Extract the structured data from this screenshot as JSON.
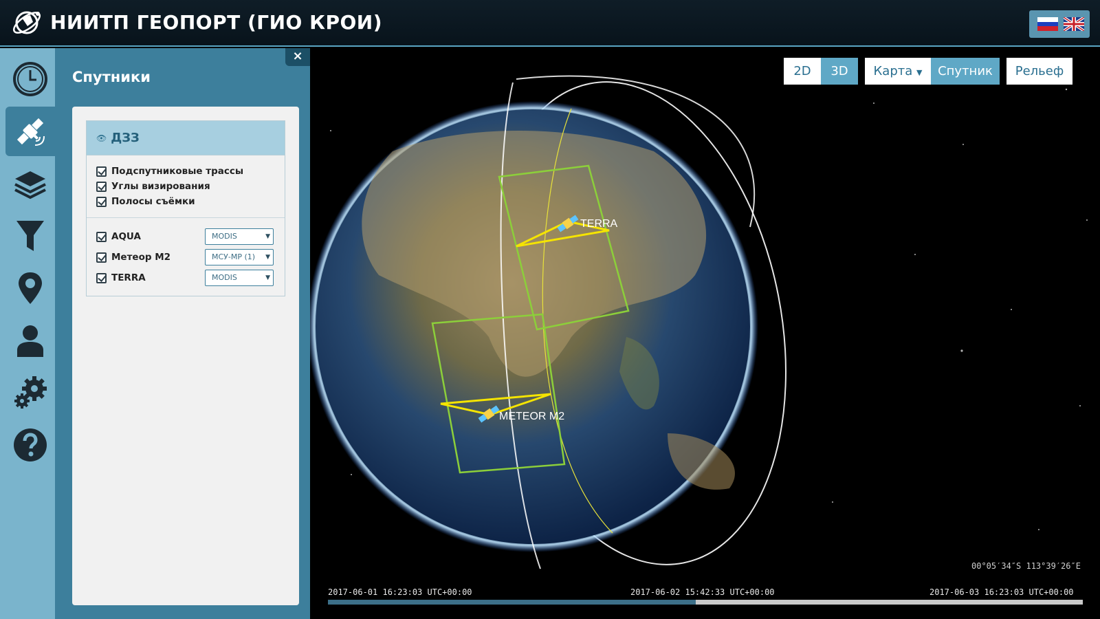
{
  "header": {
    "title": "НИИТП ГЕОПОРТ (ГИО КРОИ)"
  },
  "language": {
    "options": [
      "ru-flag",
      "uk-flag"
    ]
  },
  "iconbar": {
    "items": [
      {
        "icon": "clock-icon"
      },
      {
        "icon": "satellite-icon",
        "active": true
      },
      {
        "icon": "layers-icon"
      },
      {
        "icon": "filter-icon"
      },
      {
        "icon": "map-pin-icon"
      },
      {
        "icon": "user-icon"
      },
      {
        "icon": "gears-icon"
      },
      {
        "icon": "help-icon"
      }
    ]
  },
  "panel": {
    "title": "Спутники",
    "close": "×",
    "group": {
      "title": "ДЗЗ",
      "options": [
        {
          "label": "Подспутниковые трассы",
          "checked": true
        },
        {
          "label": "Углы визирования",
          "checked": true
        },
        {
          "label": "Полосы съёмки",
          "checked": true
        }
      ],
      "satellites": [
        {
          "label": "AQUA",
          "checked": true,
          "instrument": "MODIS"
        },
        {
          "label": "Метеор М2",
          "checked": true,
          "instrument": "МСУ-МР (1)"
        },
        {
          "label": "TERRA",
          "checked": true,
          "instrument": "MODIS"
        }
      ]
    }
  },
  "map": {
    "view_modes": [
      "2D",
      "3D"
    ],
    "active_view": "3D",
    "base_layers": [
      "Карта",
      "Спутник"
    ],
    "active_base": "Спутник",
    "relief": "Рельеф",
    "satellite_labels": [
      "TERRA",
      "METEOR M2"
    ],
    "coordinates": "00°05′34″S  113°39′26″E",
    "timeline": {
      "start": "2017-06-01 16:23:03 UTC+00:00",
      "current": "2017-06-02 15:42:33 UTC+00:00",
      "end": "2017-06-03 16:23:03 UTC+00:00",
      "progress": 0.487
    }
  },
  "colors": {
    "accent": "#3d7f9c",
    "light_accent": "#7ab4cc",
    "swath": "#8ccf3a",
    "view_angle": "#f5e400"
  }
}
